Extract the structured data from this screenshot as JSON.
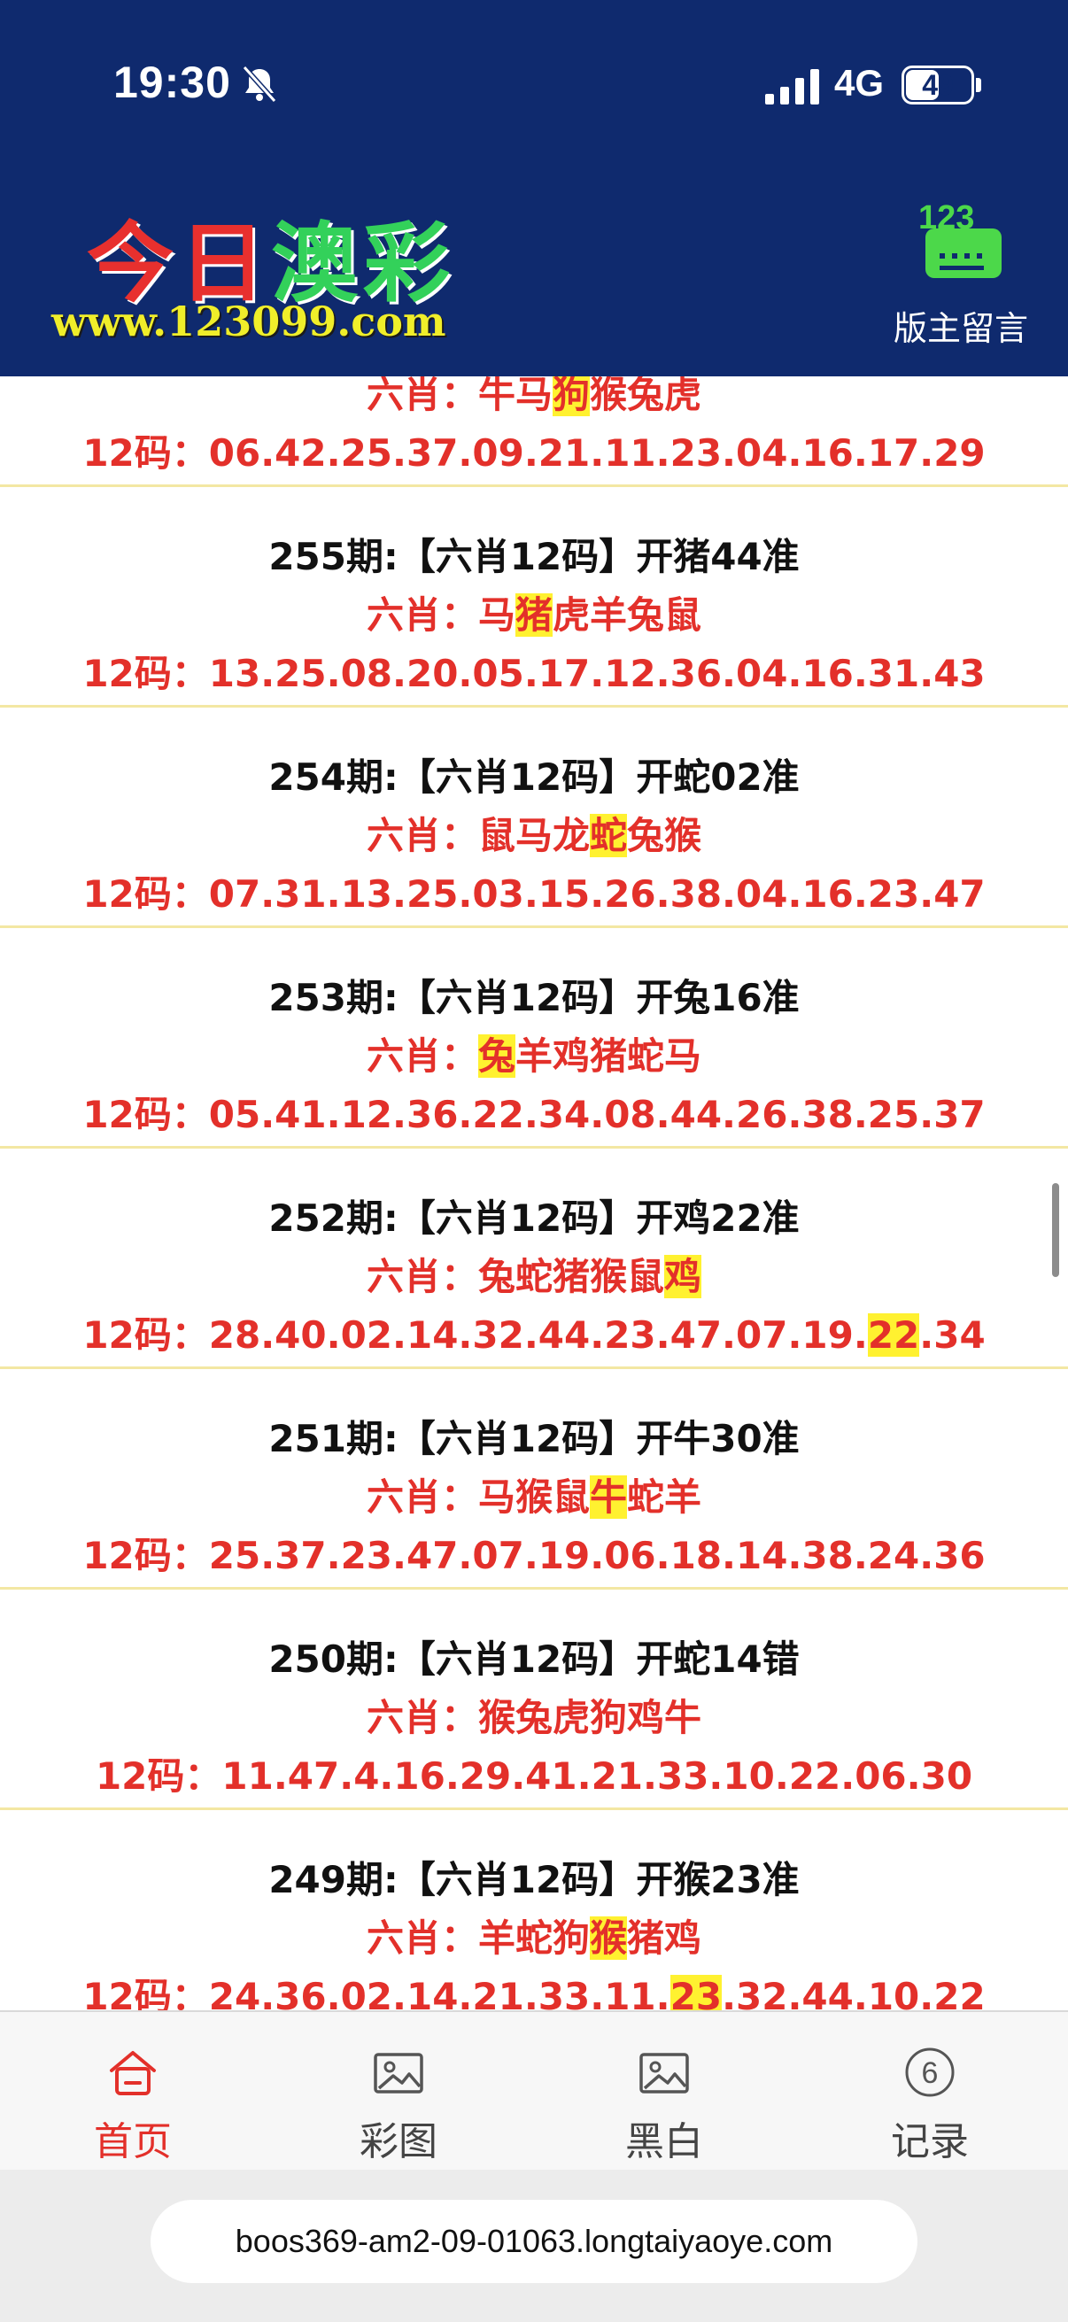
{
  "status_bar": {
    "time": "19:30",
    "network": "4G",
    "battery": "49",
    "battery_level": 0.49
  },
  "header": {
    "logo_part1": "今日",
    "logo_part2": "澳彩",
    "logo_url": "www.123099.com",
    "owner_icon_text": "123",
    "owner_label": "版主留言"
  },
  "entries": [
    {
      "title": "",
      "zodiac_label": "六肖：",
      "zodiac_pre": "牛马",
      "zodiac_hl": "狗",
      "zodiac_post": "猴兔虎",
      "codes_label": "12码：",
      "codes_pre": "06.42.25.37.09.21.11.23.04.16.17.29",
      "codes_hl": "",
      "codes_post": ""
    },
    {
      "title": "255期:【六肖12码】开猪44准",
      "zodiac_label": "六肖：",
      "zodiac_pre": "马",
      "zodiac_hl": "猪",
      "zodiac_post": "虎羊兔鼠",
      "codes_label": "12码：",
      "codes_pre": "13.25.08.20.05.17.12.36.04.16.31.43",
      "codes_hl": "",
      "codes_post": ""
    },
    {
      "title": "254期:【六肖12码】开蛇02准",
      "zodiac_label": "六肖：",
      "zodiac_pre": "鼠马龙",
      "zodiac_hl": "蛇",
      "zodiac_post": "兔猴",
      "codes_label": "12码：",
      "codes_pre": "07.31.13.25.03.15.26.38.04.16.23.47",
      "codes_hl": "",
      "codes_post": ""
    },
    {
      "title": "253期:【六肖12码】开兔16准",
      "zodiac_label": "六肖：",
      "zodiac_pre": "",
      "zodiac_hl": "兔",
      "zodiac_post": "羊鸡猪蛇马",
      "codes_label": "12码：",
      "codes_pre": "05.41.12.36.22.34.08.44.26.38.25.37",
      "codes_hl": "",
      "codes_post": ""
    },
    {
      "title": "252期:【六肖12码】开鸡22准",
      "zodiac_label": "六肖：",
      "zodiac_pre": "兔蛇猪猴鼠",
      "zodiac_hl": "鸡",
      "zodiac_post": "",
      "codes_label": "12码：",
      "codes_pre": "28.40.02.14.32.44.23.47.07.19.",
      "codes_hl": "22",
      "codes_post": ".34"
    },
    {
      "title": "251期:【六肖12码】开牛30准",
      "zodiac_label": "六肖：",
      "zodiac_pre": "马猴鼠",
      "zodiac_hl": "牛",
      "zodiac_post": "蛇羊",
      "codes_label": "12码：",
      "codes_pre": "25.37.23.47.07.19.06.18.14.38.24.36",
      "codes_hl": "",
      "codes_post": ""
    },
    {
      "title": "250期:【六肖12码】开蛇14错",
      "zodiac_label": "六肖：",
      "zodiac_pre": "猴兔虎狗鸡牛",
      "zodiac_hl": "",
      "zodiac_post": "",
      "codes_label": "12码：",
      "codes_pre": "11.47.4.16.29.41.21.33.10.22.06.30",
      "codes_hl": "",
      "codes_post": ""
    },
    {
      "title": "249期:【六肖12码】开猴23准",
      "zodiac_label": "六肖：",
      "zodiac_pre": "羊蛇狗",
      "zodiac_hl": "猴",
      "zodiac_post": "猪鸡",
      "codes_label": "12码：",
      "codes_pre": "24.36.02.14.21.33.11.",
      "codes_hl": "23",
      "codes_post": ".32.44.10.22"
    }
  ],
  "tabs": [
    {
      "label": "首页",
      "icon": "home-icon",
      "active": true
    },
    {
      "label": "彩图",
      "icon": "image-icon",
      "active": false
    },
    {
      "label": "黑白",
      "icon": "image-icon",
      "active": false
    },
    {
      "label": "记录",
      "icon": "record-icon",
      "active": false,
      "icon_text": "6"
    }
  ],
  "browser": {
    "url": "boos369-am2-09-01063.longtaiyaoye.com"
  },
  "colors": {
    "header_bg": "#0f2a6e",
    "accent_red": "#e3302a",
    "highlight": "#fff130",
    "divider": "#f3e7a3"
  }
}
